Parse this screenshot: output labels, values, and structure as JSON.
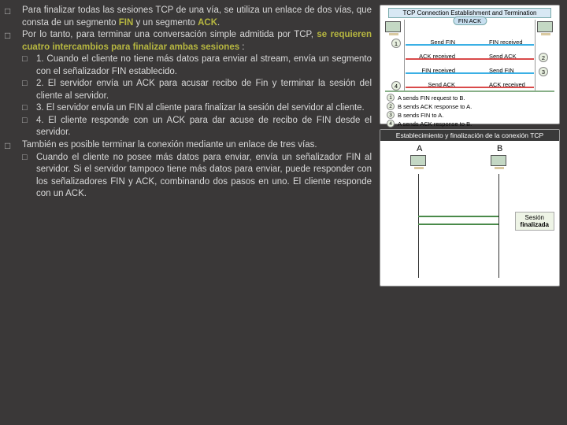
{
  "bullets": {
    "b1": {
      "pre": "Para finalizar todas las sesiones TCP de una vía, se utiliza un enlace de dos vías, que consta de un segmento ",
      "h1": "FIN",
      "mid": " y un segmento ",
      "h2": "ACK",
      "post": "."
    },
    "b2": {
      "pre": "Por lo tanto, para terminar una conversación simple admitida por TCP, ",
      "h": "se requieren cuatro intercambios para finalizar ambas sesiones",
      "post": " :"
    },
    "s1": "1. Cuando el cliente no tiene más datos para enviar al stream, envía un segmento con el señalizador FIN establecido.",
    "s2": "2. El servidor envía un ACK para acusar recibo de Fin y terminar la sesión del cliente al servidor.",
    "s3": "3. El servidor envía un FIN al cliente para finalizar la sesión del servidor al cliente.",
    "s4": "4. El cliente responde con un ACK para dar acuse de recibo de FIN desde el servidor.",
    "b3": "También es posible terminar la conexión mediante un enlace de tres vías.",
    "s5": "Cuando el cliente no posee más datos para enviar, envía un señalizador FIN al servidor. Si el servidor tampoco tiene más datos para enviar, puede responder con los señalizadores FIN y ACK, combinando dos pasos en uno. El cliente responde con un ACK."
  },
  "dia1": {
    "title": "TCP Connection Establishment and Termination",
    "badge": "FIN ACK",
    "rows": {
      "l1": "Send FIN",
      "r1": "FIN received",
      "l2": "ACK received",
      "r2": "Send ACK",
      "l3": "FIN received",
      "r3": "Send FIN",
      "l4": "Send ACK",
      "r4": "ACK received"
    },
    "legend": {
      "l1": "A sends FIN request to B.",
      "l2": "B sends ACK response to A.",
      "l3": "B sends FIN to A.",
      "l4": "A sends ACK response to B."
    }
  },
  "dia2": {
    "title": "Establecimiento y finalización de la conexión TCP",
    "labA": "A",
    "labB": "B",
    "sesion": "Sesión",
    "finalizada": "finalizada"
  }
}
